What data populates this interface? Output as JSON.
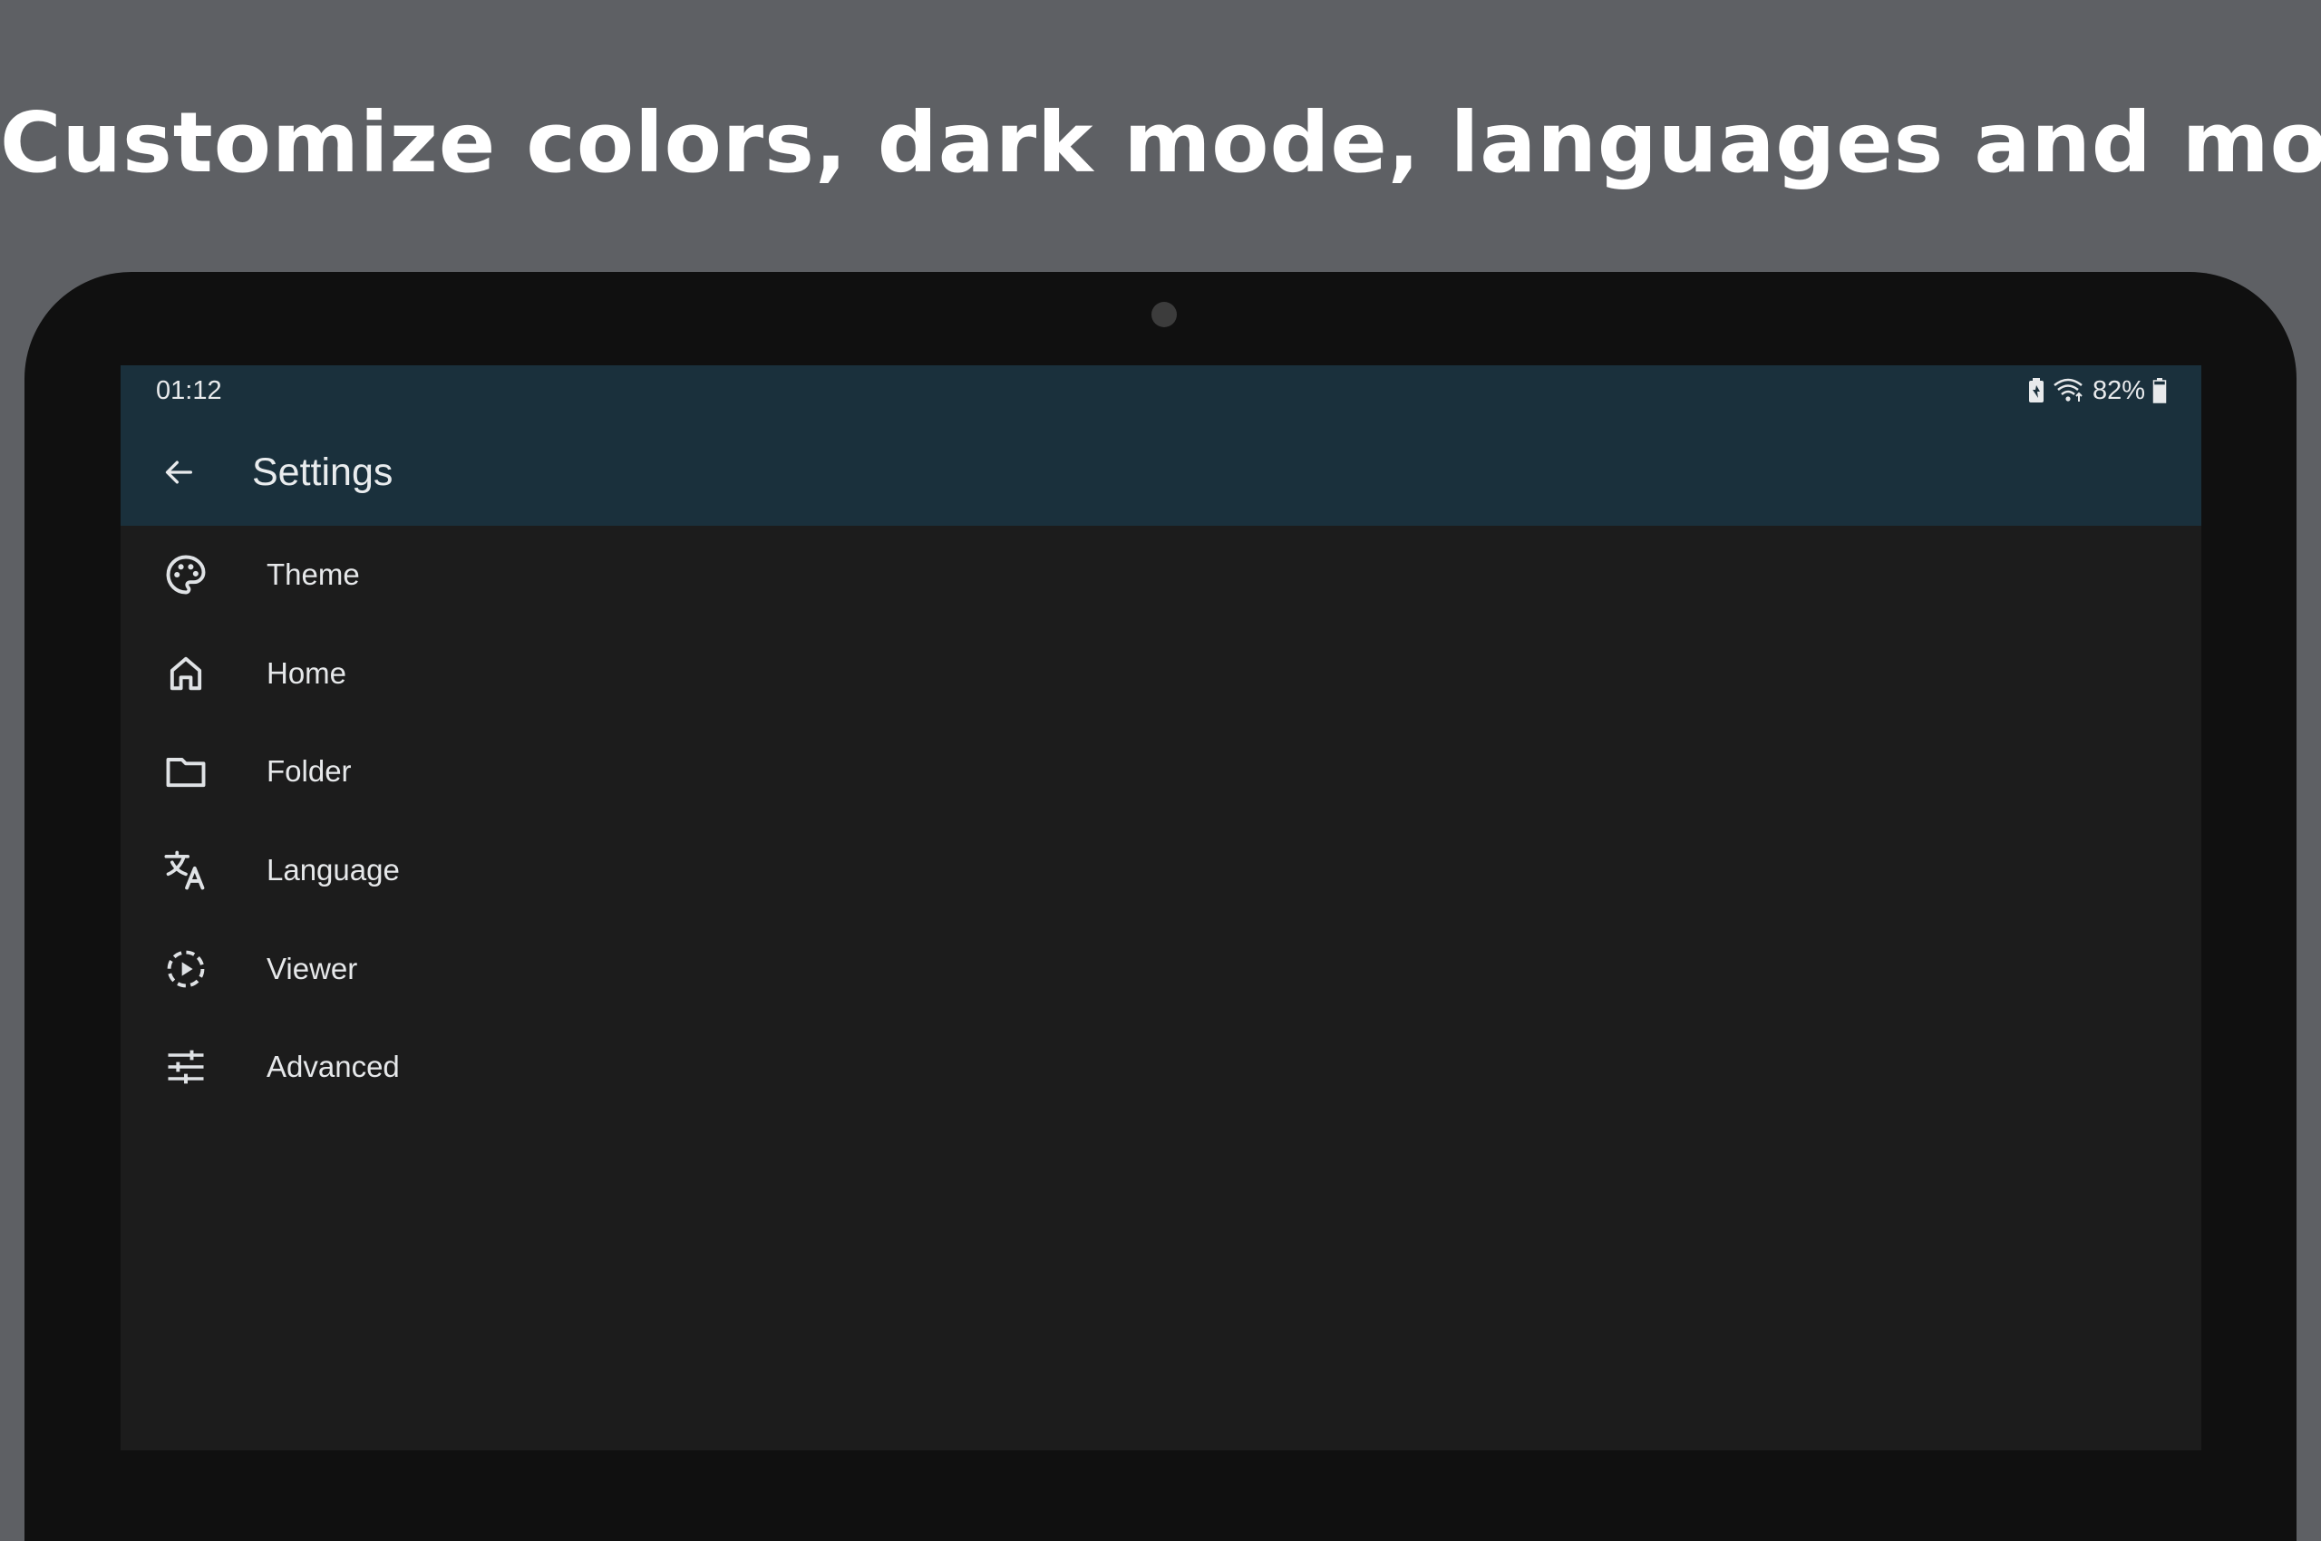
{
  "promo": {
    "heading": "Customize colors, dark mode, languages and more"
  },
  "status_bar": {
    "time": "01:12",
    "battery_percent": "82%",
    "battery_level": 0.82,
    "icons": [
      "battery-saver-icon",
      "wifi-icon",
      "battery-icon"
    ]
  },
  "appbar": {
    "title": "Settings",
    "back_icon": "arrow-back-icon"
  },
  "settings": {
    "items": [
      {
        "label": "Theme",
        "icon": "palette-icon"
      },
      {
        "label": "Home",
        "icon": "home-icon"
      },
      {
        "label": "Folder",
        "icon": "folder-icon"
      },
      {
        "label": "Language",
        "icon": "translate-icon"
      },
      {
        "label": "Viewer",
        "icon": "slideshow-icon"
      },
      {
        "label": "Advanced",
        "icon": "tune-icon"
      }
    ]
  },
  "colors": {
    "page_background": "#5e6064",
    "device_frame": "#101010",
    "appbar": "#1a303c",
    "screen_background": "#1c1c1c",
    "text": "#e6e8ea"
  }
}
